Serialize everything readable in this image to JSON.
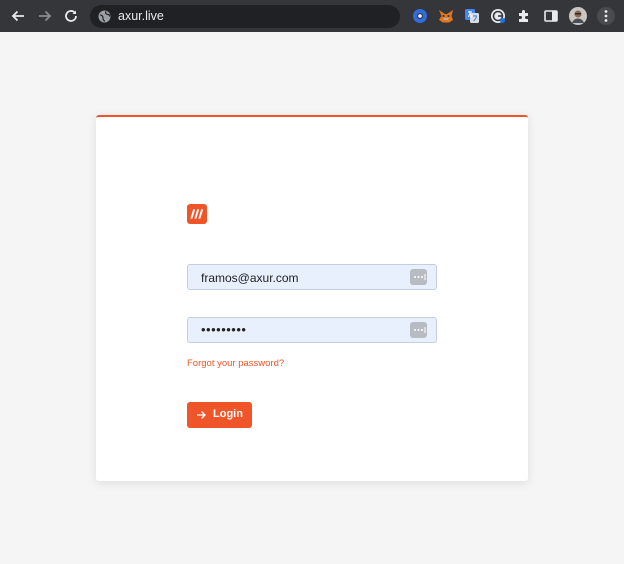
{
  "browser": {
    "url": "axur.live",
    "icons": {
      "back": "arrow-left-icon",
      "forward": "arrow-right-icon",
      "reload": "reload-icon",
      "site": "globe-icon",
      "extensions": [
        "circle-extension-icon",
        "metamask-fox-icon",
        "google-translate-icon",
        "grammar-extension-icon",
        "puzzle-piece-icon",
        "side-panel-icon",
        "profile-avatar-icon",
        "kebab-menu-icon"
      ]
    }
  },
  "login": {
    "email_value": "framos@axur.com",
    "password_value": "•••••••••",
    "forgot_label": "Forgot your password?",
    "login_label": "Login"
  },
  "colors": {
    "accent": "#f0552a",
    "input_bg": "#e8f0fe",
    "page_bg": "#f5f5f5",
    "chrome_bg": "#35363a"
  }
}
